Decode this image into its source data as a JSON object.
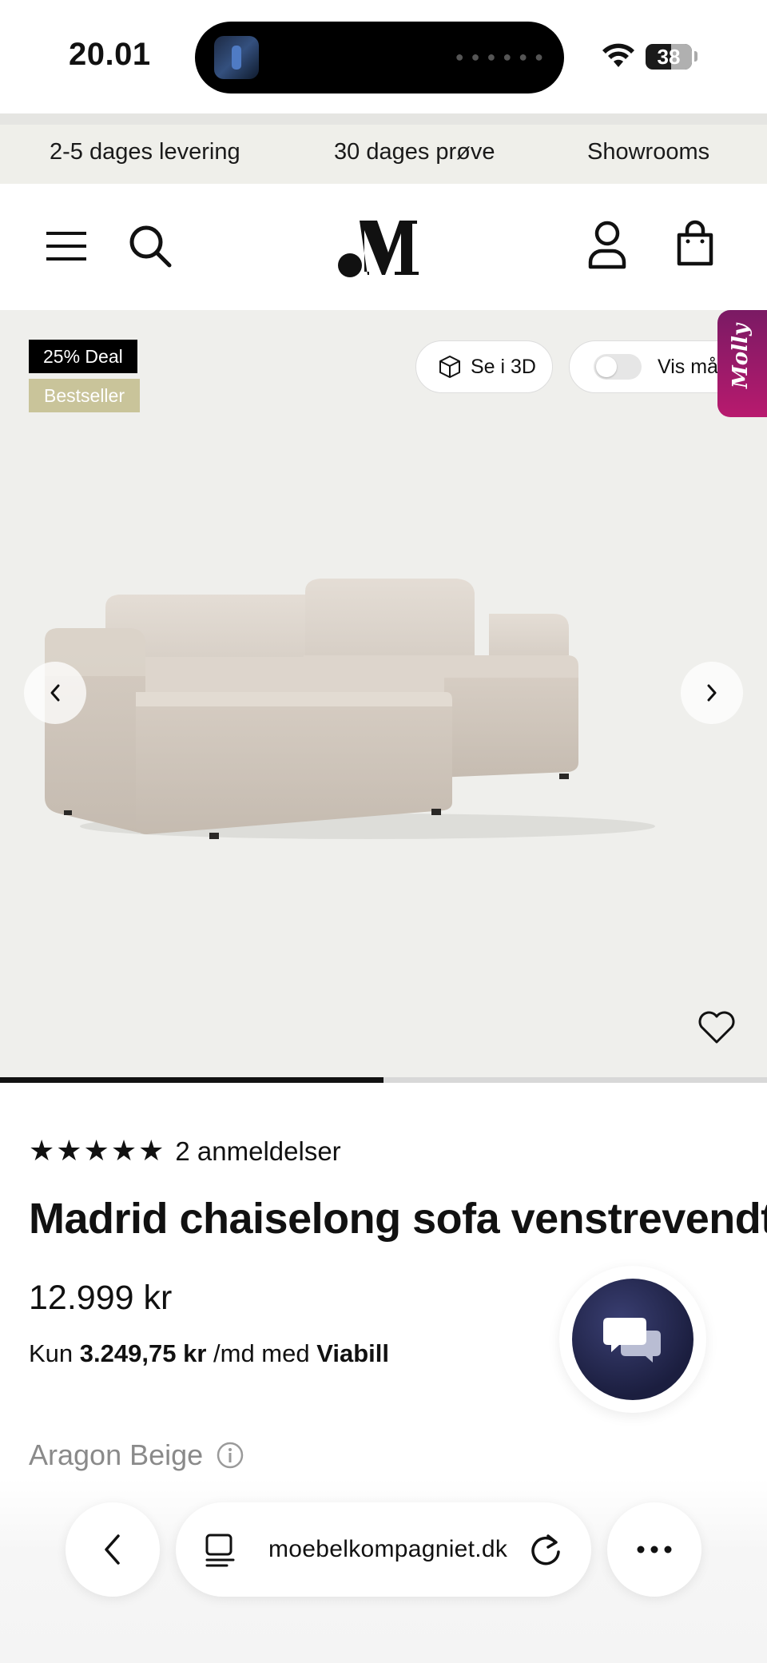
{
  "status_bar": {
    "time": "20.01",
    "battery": "38"
  },
  "usp_bar": {
    "items": [
      "2-5 dages levering",
      "30 dages prøve",
      "Showrooms"
    ]
  },
  "header": {
    "logo_text": "M"
  },
  "gallery": {
    "badges": {
      "deal": "25% Deal",
      "bestseller": "Bestseller"
    },
    "view_3d_label": "Se i 3D",
    "measure_toggle_label": "Vis mål",
    "molly_tab_label": "Molly",
    "progress_fraction": 0.5
  },
  "product": {
    "stars": "★★★★★",
    "review_count": "2 anmeldelser",
    "title": "Madrid chaiselong sofa venstrevendt",
    "price": "12.999 kr",
    "finance": {
      "prefix": "Kun",
      "amount": "3.249,75 kr",
      "middle": "/md med",
      "provider": "Viabill"
    },
    "variant": "Aragon Beige"
  },
  "browser_bar": {
    "url": "moebelkompagniet.dk"
  },
  "colors": {
    "badge_deal": "#000000",
    "badge_bestseller": "#c9c49a",
    "molly": "#b81a6e",
    "chat": "#1b1e3f"
  }
}
